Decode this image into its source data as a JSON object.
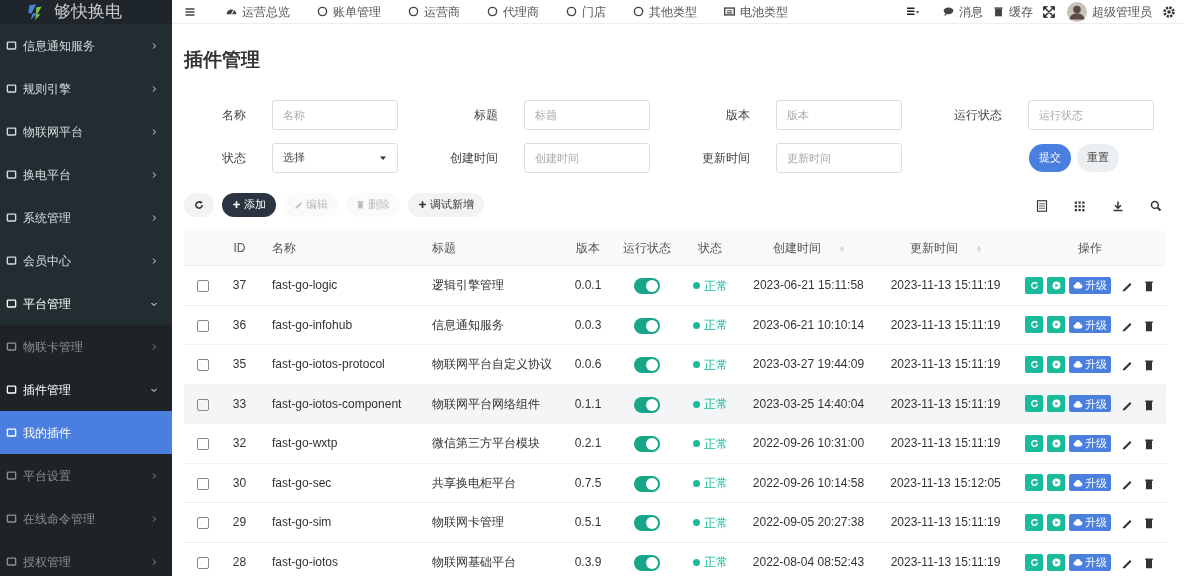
{
  "brand": {
    "name": "够快换电"
  },
  "sidebar": {
    "items": [
      {
        "label": "信息通知服务",
        "expanded": false,
        "selected": false
      },
      {
        "label": "规则引擎",
        "expanded": false,
        "selected": false
      },
      {
        "label": "物联网平台",
        "expanded": false,
        "selected": false
      },
      {
        "label": "换电平台",
        "expanded": false,
        "selected": false
      },
      {
        "label": "系统管理",
        "expanded": false,
        "selected": false
      },
      {
        "label": "会员中心",
        "expanded": false,
        "selected": false
      },
      {
        "label": "平台管理",
        "expanded": true,
        "selected": false,
        "children": [
          {
            "label": "物联卡管理",
            "expanded": false,
            "selected": false
          },
          {
            "label": "插件管理",
            "expanded": true,
            "selected": false,
            "children": [
              {
                "label": "我的插件",
                "selected": true
              }
            ]
          },
          {
            "label": "平台设置",
            "expanded": false,
            "selected": false
          },
          {
            "label": "在线命令管理",
            "expanded": false,
            "selected": false
          },
          {
            "label": "授权管理",
            "expanded": false,
            "selected": false
          }
        ]
      }
    ]
  },
  "topnav": {
    "items": [
      {
        "label": "运营总览",
        "kind": "gauge"
      },
      {
        "label": "账单管理",
        "kind": "circle"
      },
      {
        "label": "运营商",
        "kind": "circle"
      },
      {
        "label": "代理商",
        "kind": "circle"
      },
      {
        "label": "门店",
        "kind": "circle"
      },
      {
        "label": "其他类型",
        "kind": "circle"
      },
      {
        "label": "电池类型",
        "kind": "battery"
      }
    ],
    "messages": "消息",
    "cache": "缓存",
    "user": "超级管理员"
  },
  "page_title": "插件管理",
  "filters": [
    {
      "label": "名称",
      "kind": "input",
      "placeholder": "名称"
    },
    {
      "label": "标题",
      "kind": "input",
      "placeholder": "标题"
    },
    {
      "label": "版本",
      "kind": "input",
      "placeholder": "版本"
    },
    {
      "label": "运行状态",
      "kind": "input",
      "placeholder": "运行状态"
    },
    {
      "label": "状态",
      "kind": "select",
      "value": "选择"
    },
    {
      "label": "创建时间",
      "kind": "input",
      "placeholder": "创建时间"
    },
    {
      "label": "更新时间",
      "kind": "input",
      "placeholder": "更新时间"
    }
  ],
  "form_buttons": [
    {
      "label": "提交",
      "kind": "primary"
    },
    {
      "label": "重置",
      "kind": "secondary"
    }
  ],
  "toolbar": [
    {
      "label": "添加",
      "kind": "dark",
      "disabled": false
    },
    {
      "label": "编辑",
      "kind": "light",
      "disabled": true
    },
    {
      "label": "删除",
      "kind": "light",
      "disabled": true
    },
    {
      "label": "调试新增",
      "kind": "light",
      "disabled": false
    }
  ],
  "table": {
    "columns": [
      {
        "label": "ID",
        "sortable": false
      },
      {
        "label": "名称",
        "sortable": false
      },
      {
        "label": "标题",
        "sortable": false
      },
      {
        "label": "版本",
        "sortable": false
      },
      {
        "label": "运行状态",
        "sortable": false
      },
      {
        "label": "状态",
        "sortable": false
      },
      {
        "label": "创建时间",
        "sortable": true
      },
      {
        "label": "更新时间",
        "sortable": true
      },
      {
        "label": "操作",
        "sortable": false
      }
    ],
    "rows": [
      {
        "checked": false,
        "hovered": false,
        "id": "37",
        "name": "fast-go-logic",
        "title": "逻辑引擎管理",
        "version": "0.0.1",
        "running": true,
        "status": "正常",
        "color": "#18bc9c",
        "created": "2023-06-21 15:11:58",
        "updated": "2023-11-13 15:11:19",
        "upgrade": "升级"
      },
      {
        "checked": false,
        "hovered": false,
        "id": "36",
        "name": "fast-go-infohub",
        "title": "信息通知服务",
        "version": "0.0.3",
        "running": true,
        "status": "正常",
        "color": "#18bc9c",
        "created": "2023-06-21 10:10:14",
        "updated": "2023-11-13 15:11:19",
        "upgrade": "升级"
      },
      {
        "checked": false,
        "hovered": false,
        "id": "35",
        "name": "fast-go-iotos-protocol",
        "title": "物联网平台自定义协议",
        "version": "0.0.6",
        "running": true,
        "status": "正常",
        "color": "#18bc9c",
        "created": "2023-03-27 19:44:09",
        "updated": "2023-11-13 15:11:19",
        "upgrade": "升级"
      },
      {
        "checked": false,
        "hovered": true,
        "id": "33",
        "name": "fast-go-iotos-component",
        "title": "物联网平台网络组件",
        "version": "0.1.1",
        "running": true,
        "status": "正常",
        "color": "#18bc9c",
        "created": "2023-03-25 14:40:04",
        "updated": "2023-11-13 15:11:19",
        "upgrade": "升级"
      },
      {
        "checked": false,
        "hovered": false,
        "id": "32",
        "name": "fast-go-wxtp",
        "title": "微信第三方平台模块",
        "version": "0.2.1",
        "running": true,
        "status": "正常",
        "color": "#18bc9c",
        "created": "2022-09-26 10:31:00",
        "updated": "2023-11-13 15:11:19",
        "upgrade": "升级"
      },
      {
        "checked": false,
        "hovered": false,
        "id": "30",
        "name": "fast-go-sec",
        "title": "共享换电柜平台",
        "version": "0.7.5",
        "running": true,
        "status": "正常",
        "color": "#18bc9c",
        "created": "2022-09-26 10:14:58",
        "updated": "2023-11-13 15:12:05",
        "upgrade": "升级"
      },
      {
        "checked": false,
        "hovered": false,
        "id": "29",
        "name": "fast-go-sim",
        "title": "物联网卡管理",
        "version": "0.5.1",
        "running": true,
        "status": "正常",
        "color": "#18bc9c",
        "created": "2022-09-05 20:27:38",
        "updated": "2023-11-13 15:11:19",
        "upgrade": "升级"
      },
      {
        "checked": false,
        "hovered": false,
        "id": "28",
        "name": "fast-go-iotos",
        "title": "物联网基础平台",
        "version": "0.3.9",
        "running": true,
        "status": "正常",
        "color": "#18bc9c",
        "created": "2022-08-04 08:52:43",
        "updated": "2023-11-13 15:11:19",
        "upgrade": "升级"
      }
    ]
  }
}
